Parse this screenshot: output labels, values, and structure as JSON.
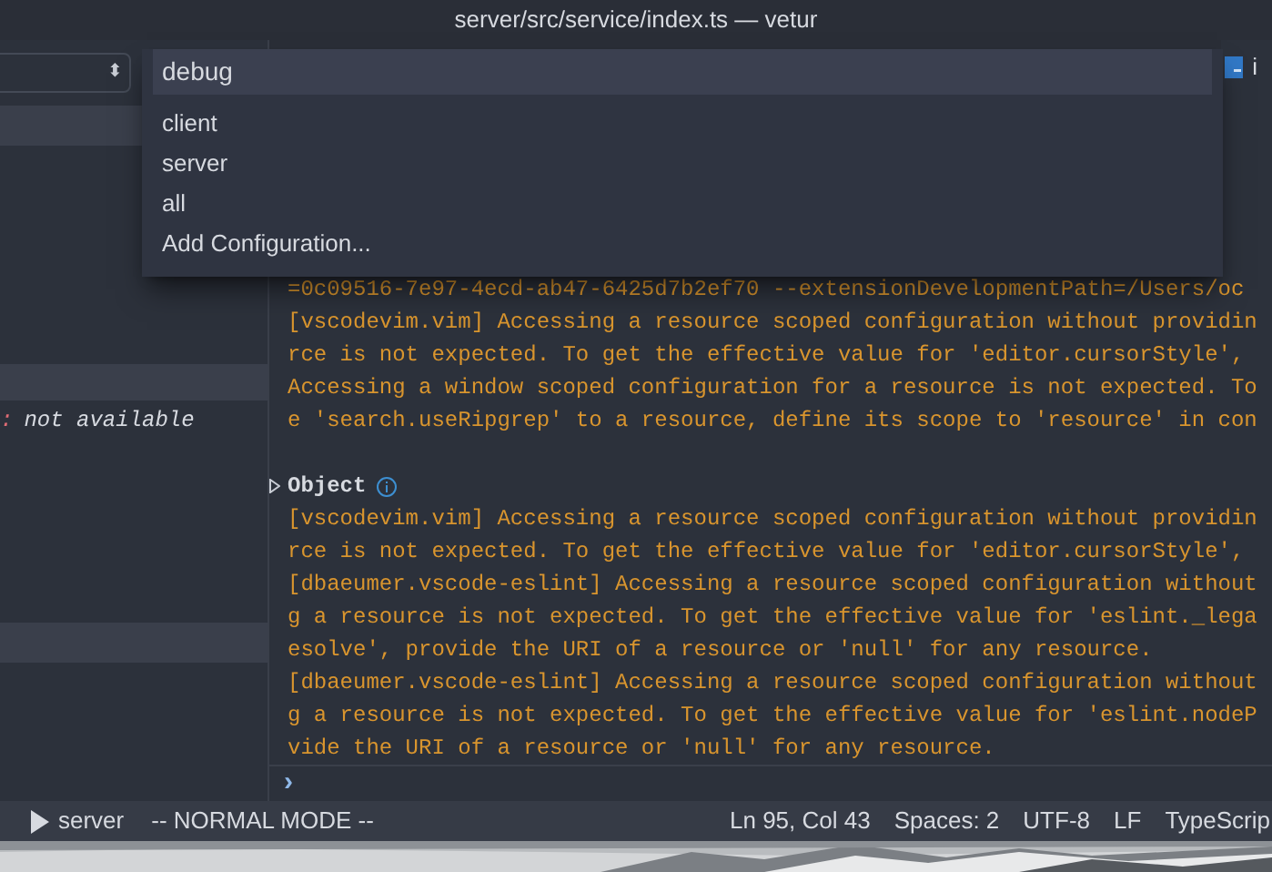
{
  "window": {
    "title": "server/src/service/index.ts — vetur"
  },
  "sidebar": {
    "selector_icon": "⬍",
    "variable": {
      "separator": ":",
      "value": "not available"
    }
  },
  "editor_tab": {
    "label": "i"
  },
  "quick_pick": {
    "value": "debug",
    "items": [
      {
        "label": "client"
      },
      {
        "label": "server"
      },
      {
        "label": "all"
      },
      {
        "label": "Add Configuration..."
      }
    ]
  },
  "console": {
    "lines": [
      {
        "kind": "text",
        "text": "=0c09516-7e97-4ecd-ab47-6425d7b2ef70 --extensionDevelopmentPath=/Users/oc"
      },
      {
        "kind": "text",
        "text": "[vscodevim.vim] Accessing a resource scoped configuration without providin"
      },
      {
        "kind": "text",
        "text": "rce is not expected. To get the effective value for 'editor.cursorStyle',"
      },
      {
        "kind": "text",
        "text": "Accessing a window scoped configuration for a resource is not expected. To"
      },
      {
        "kind": "text",
        "text": "e 'search.useRipgrep' to a resource, define its scope to 'resource' in con"
      },
      {
        "kind": "blank"
      },
      {
        "kind": "object",
        "text": "Object",
        "expanded": false
      },
      {
        "kind": "text",
        "text": "[vscodevim.vim] Accessing a resource scoped configuration without providin"
      },
      {
        "kind": "text",
        "text": "rce is not expected. To get the effective value for 'editor.cursorStyle',"
      },
      {
        "kind": "text",
        "text": "[dbaeumer.vscode-eslint] Accessing a resource scoped configuration without"
      },
      {
        "kind": "text",
        "text": "g a resource is not expected. To get the effective value for 'eslint._lega"
      },
      {
        "kind": "text",
        "text": "esolve', provide the URI of a resource or 'null' for any resource."
      },
      {
        "kind": "text",
        "text": "[dbaeumer.vscode-eslint] Accessing a resource scoped configuration without"
      },
      {
        "kind": "text",
        "text": "g a resource is not expected. To get the effective value for 'eslint.nodeP"
      },
      {
        "kind": "text",
        "text": "vide the URI of a resource or 'null' for any resource."
      }
    ],
    "prompt": "›"
  },
  "status_bar": {
    "debug_target": "server",
    "vim_mode": "-- NORMAL MODE --",
    "items": [
      "Ln 95, Col 43",
      "Spaces: 2",
      "UTF-8",
      "LF",
      "TypeScrip"
    ]
  }
}
